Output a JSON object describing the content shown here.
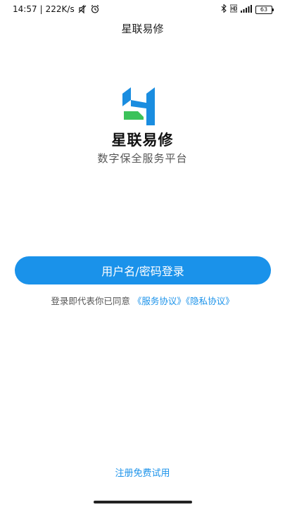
{
  "status_bar": {
    "time": "14:57",
    "separator": "|",
    "network_speed": "222K/s",
    "battery_level": "63",
    "icons": [
      "mute-icon",
      "alarm-icon",
      "bluetooth-icon",
      "hd-icon",
      "signal-icon",
      "battery-icon"
    ]
  },
  "header": {
    "title": "星联易修"
  },
  "brand": {
    "name": "星联易修",
    "slogan": "数字保全服务平台",
    "logo_colors": {
      "blue": "#1a8de0",
      "green": "#3cc25a"
    }
  },
  "login": {
    "button_label": "用户名/密码登录"
  },
  "agreement": {
    "prefix": "登录即代表你已同意",
    "service_link": "《服务协议》",
    "privacy_link": "《隐私协议》"
  },
  "footer": {
    "register_label": "注册免费试用"
  },
  "colors": {
    "accent": "#1a92ea",
    "background": "#ffffff"
  }
}
